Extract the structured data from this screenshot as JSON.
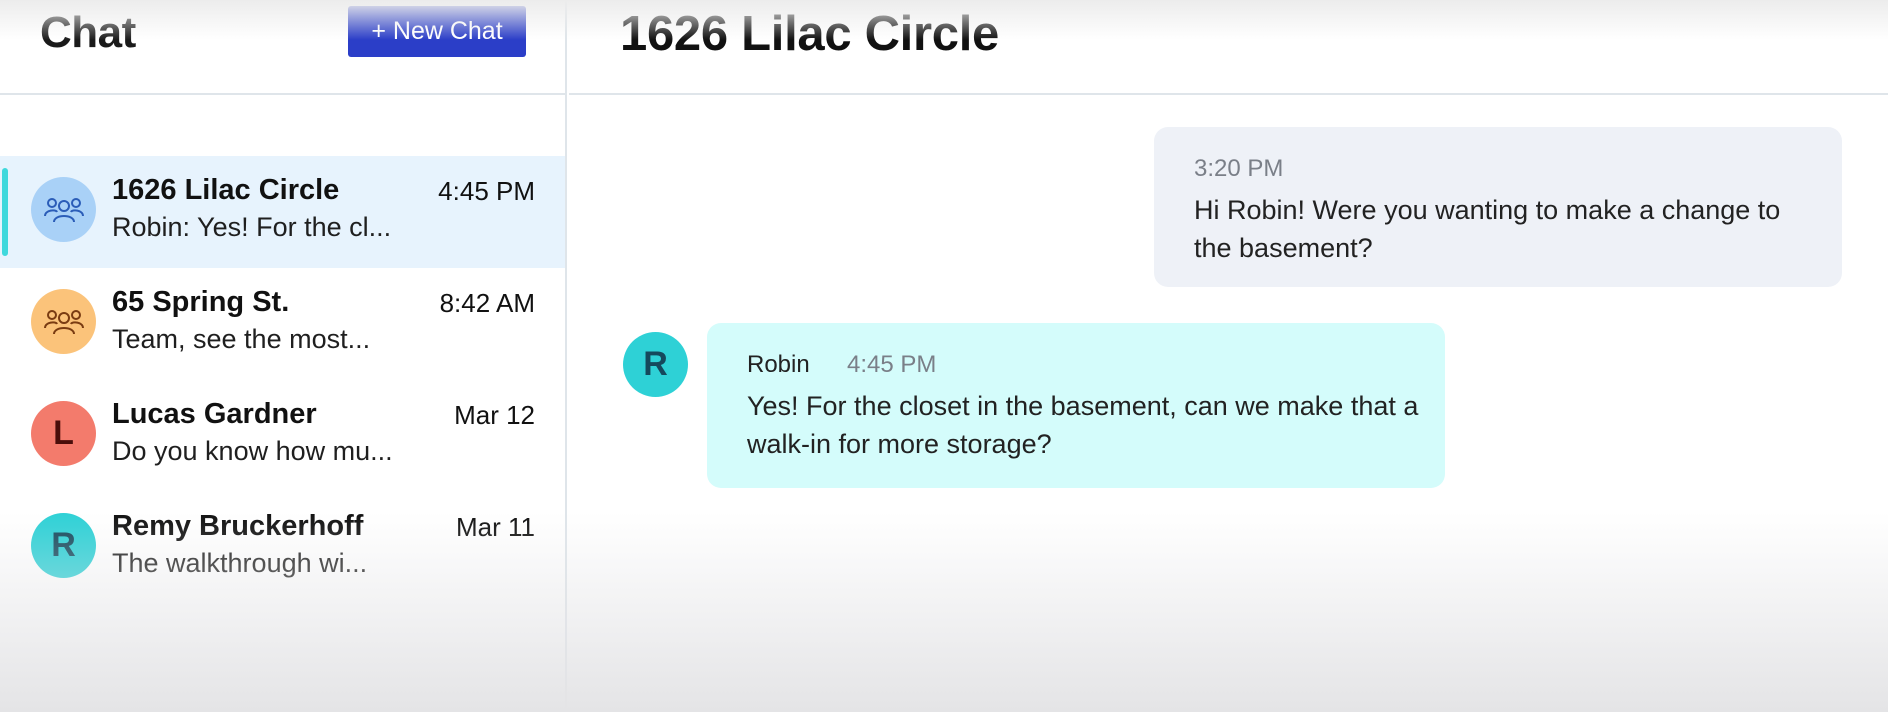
{
  "sidebar": {
    "title": "Chat",
    "new_chat_label": "+ New Chat",
    "conversations": [
      {
        "name": "1626 Lilac Circle",
        "time": "4:45 PM",
        "preview": "Robin: Yes! For the cl...",
        "avatar_type": "group-icon",
        "avatar_bg": "#a9d1f7",
        "avatar_fg": "#2b5db8",
        "active": true
      },
      {
        "name": "65 Spring St.",
        "time": "8:42 AM",
        "preview": "Team, see the most...",
        "avatar_type": "group-icon",
        "avatar_bg": "#fbc37a",
        "avatar_fg": "#7a3c12",
        "active": false
      },
      {
        "name": "Lucas Gardner",
        "time": "Mar 12",
        "preview": "Do you know how mu...",
        "avatar_letter": "L",
        "avatar_bg": "#f37b6c",
        "avatar_fg": "#4a0e0a",
        "active": false
      },
      {
        "name": "Remy Bruckerhoff",
        "time": "Mar 11",
        "preview": "The walkthrough wi...",
        "avatar_letter": "R",
        "avatar_bg": "#2ed1d6",
        "avatar_fg": "#15495c",
        "active": false
      }
    ]
  },
  "main": {
    "title": "1626 Lilac Circle",
    "messages": [
      {
        "direction": "outgoing",
        "time": "3:20 PM",
        "text": "Hi Robin! Were you wanting to make a change to the basement?"
      },
      {
        "direction": "incoming",
        "sender": "Robin",
        "avatar_letter": "R",
        "time": "4:45 PM",
        "text": "Yes! For the closet in the basement, can we make that a walk-in for more storage?"
      }
    ]
  },
  "colors": {
    "accent": "#2b3ec8",
    "active_row_bg": "#e7f3fd",
    "active_indicator": "#3fd8dc",
    "outgoing_bubble": "#eef1f7",
    "incoming_bubble": "#d4fcfb"
  }
}
